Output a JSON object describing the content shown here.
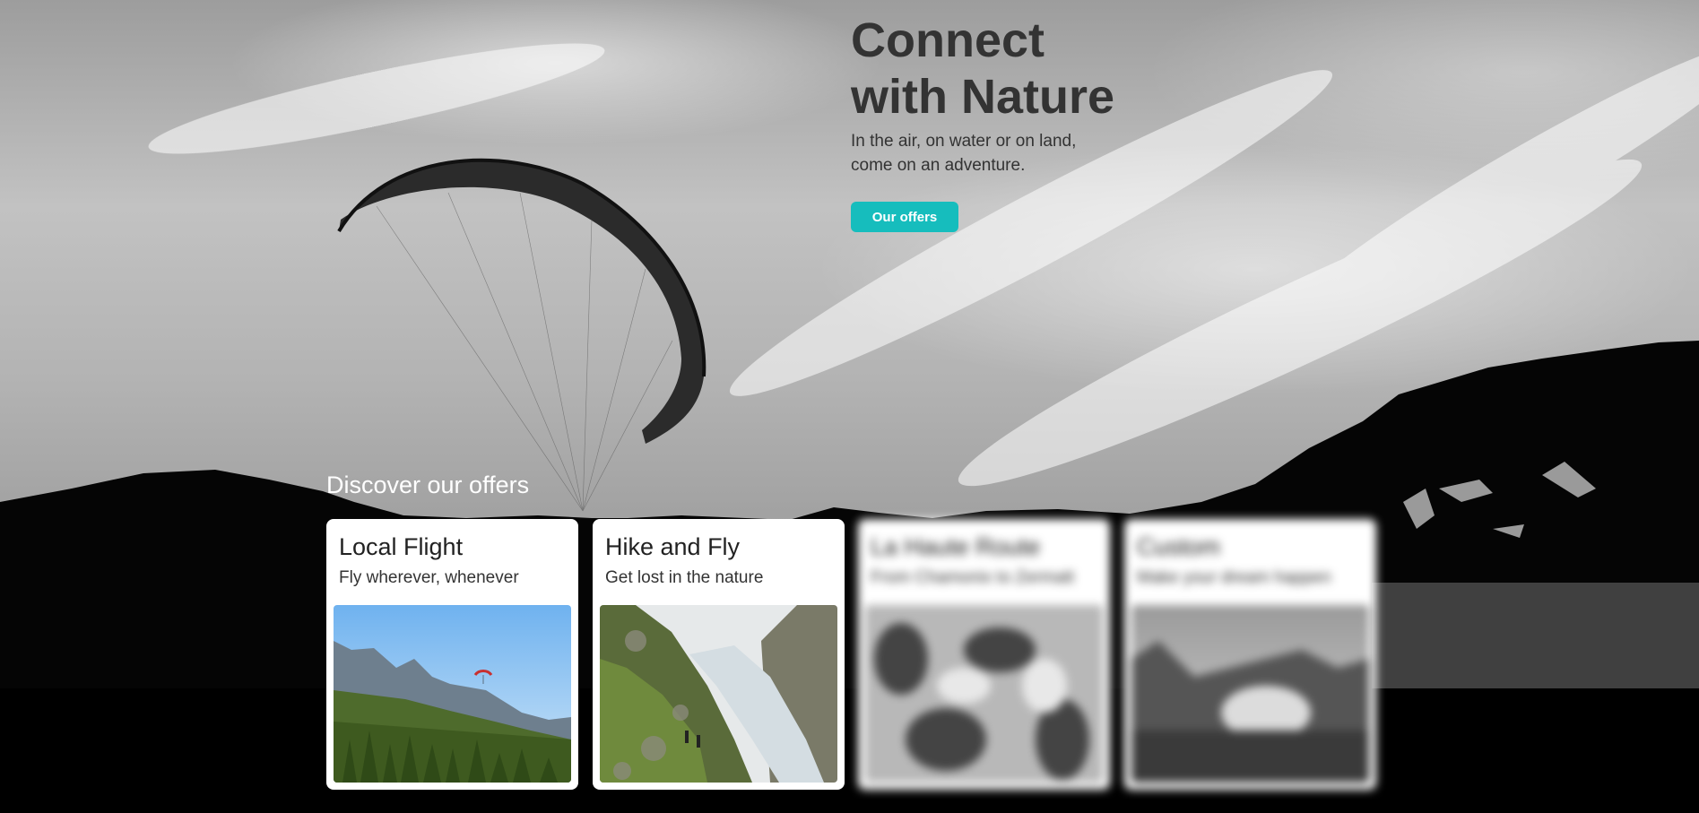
{
  "hero": {
    "title_line1": "Connect",
    "title_line2": "with Nature",
    "subtitle_line1": "In the air, on water or on land,",
    "subtitle_line2": "come on an adventure.",
    "cta_label": "Our offers"
  },
  "offers": {
    "heading": "Discover our offers",
    "cards": [
      {
        "title": "Local Flight",
        "subtitle": "Fly wherever, whenever"
      },
      {
        "title": "Hike and Fly",
        "subtitle": "Get lost in the nature"
      },
      {
        "title": "La Haute Route",
        "subtitle": "From Chamonix to Zermatt"
      },
      {
        "title": "Custom",
        "subtitle": "Make your dream happen"
      }
    ]
  },
  "colors": {
    "accent": "#16bdbd",
    "text_dark": "#333333",
    "background": "#000000",
    "card": "#ffffff"
  }
}
